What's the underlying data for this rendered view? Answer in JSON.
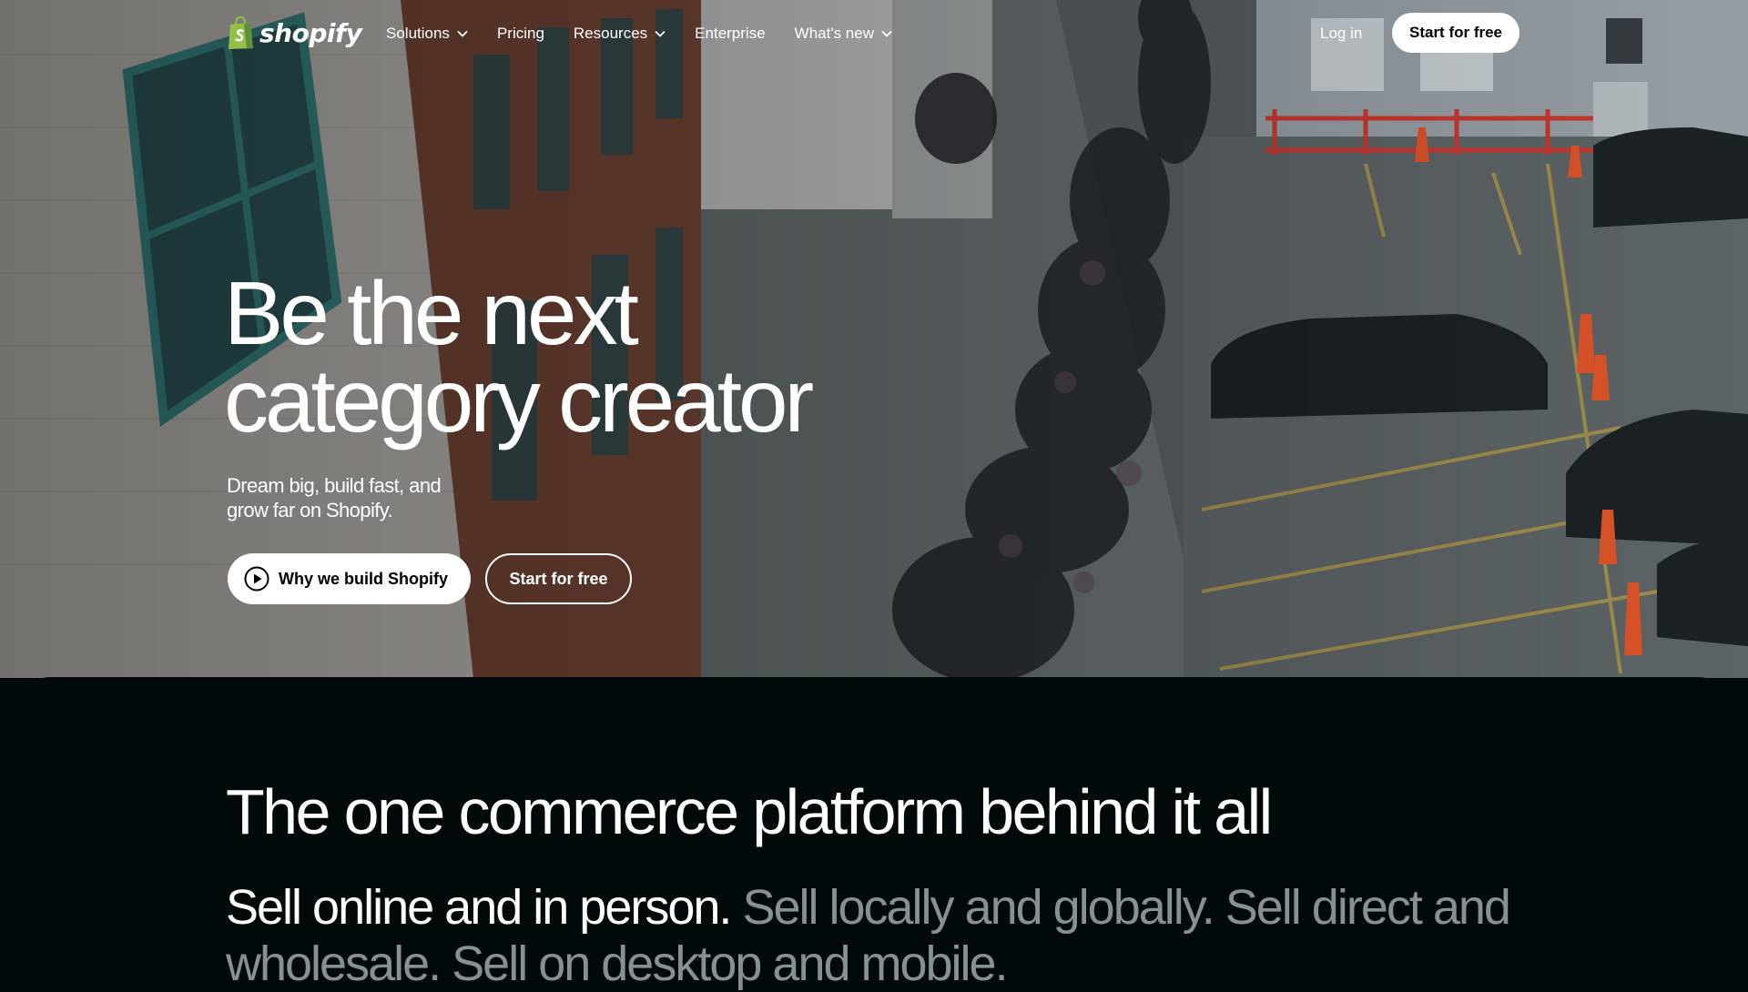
{
  "nav": {
    "logo_text": "shopify",
    "links": [
      {
        "label": "Solutions",
        "dropdown": true
      },
      {
        "label": "Pricing",
        "dropdown": false
      },
      {
        "label": "Resources",
        "dropdown": true
      },
      {
        "label": "Enterprise",
        "dropdown": false
      },
      {
        "label": "What's new",
        "dropdown": true
      }
    ],
    "login_label": "Log in",
    "cta_label": "Start for free"
  },
  "hero": {
    "title_line1": "Be the next",
    "title_line2": "category creator",
    "subtitle_line1": "Dream big, build fast, and",
    "subtitle_line2": "grow far on Shopify.",
    "primary_button": "Why we build Shopify",
    "primary_button_icon": "play-icon",
    "secondary_button": "Start for free"
  },
  "platform": {
    "title": "The one commerce platform behind it all",
    "sell_strong": "Sell online and in person.",
    "sell_dim": "Sell locally and globally. Sell direct and wholesale. Sell on desktop and mobile."
  },
  "colors": {
    "brand_green": "#95bf47",
    "dark_background": "#02090a",
    "dim_text": "#8a9092",
    "white": "#ffffff"
  }
}
